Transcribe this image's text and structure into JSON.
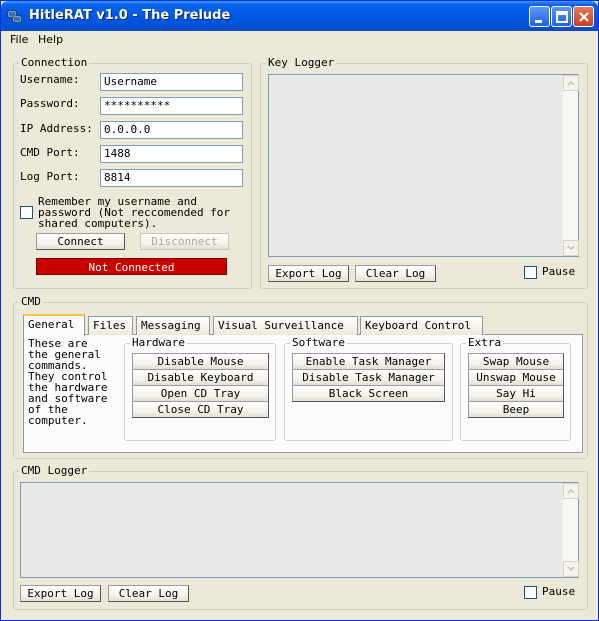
{
  "window": {
    "title": "HitleRAT v1.0 - The Prelude"
  },
  "menu": {
    "items": [
      "File",
      "Help"
    ]
  },
  "connection": {
    "title": "Connection",
    "username_label": "Username:",
    "username_value": "Username",
    "password_label": "Password:",
    "password_value": "**********",
    "ip_label": "IP Address:",
    "ip_value": "0.0.0.0",
    "cmd_port_label": "CMD Port:",
    "cmd_port_value": "1488",
    "log_port_label": "Log Port:",
    "log_port_value": "8814",
    "remember_line1": "Remember my username and",
    "remember_line2": "password (Not reccomended for",
    "remember_line3": "shared computers).",
    "remember_checked": false,
    "connect_label": "Connect",
    "disconnect_label": "Disconnect",
    "status_text": "Not Connected",
    "status_color": "#c80000"
  },
  "key_logger": {
    "title": "Key Logger",
    "export_label": "Export Log",
    "clear_label": "Clear Log",
    "pause_label": "Pause",
    "pause_checked": false
  },
  "cmd": {
    "title": "CMD",
    "tabs": [
      "General",
      "Files",
      "Messaging",
      "Visual Surveillance",
      "Keyboard Control"
    ],
    "active_tab": "General",
    "description": [
      "These are",
      "the general",
      "commands.",
      "They control",
      "the hardware",
      "and software",
      "of the",
      "computer."
    ],
    "hardware": {
      "title": "Hardware",
      "buttons": [
        "Disable Mouse",
        "Disable Keyboard",
        "Open CD Tray",
        "Close CD Tray"
      ]
    },
    "software": {
      "title": "Software",
      "buttons": [
        "Enable Task Manager",
        "Disable Task Manager",
        "Black Screen"
      ]
    },
    "extra": {
      "title": "Extra",
      "buttons": [
        "Swap Mouse",
        "Unswap Mouse",
        "Say Hi",
        "Beep"
      ]
    }
  },
  "cmd_logger": {
    "title": "CMD Logger",
    "export_label": "Export Log",
    "clear_label": "Clear Log",
    "pause_label": "Pause",
    "pause_checked": false
  }
}
